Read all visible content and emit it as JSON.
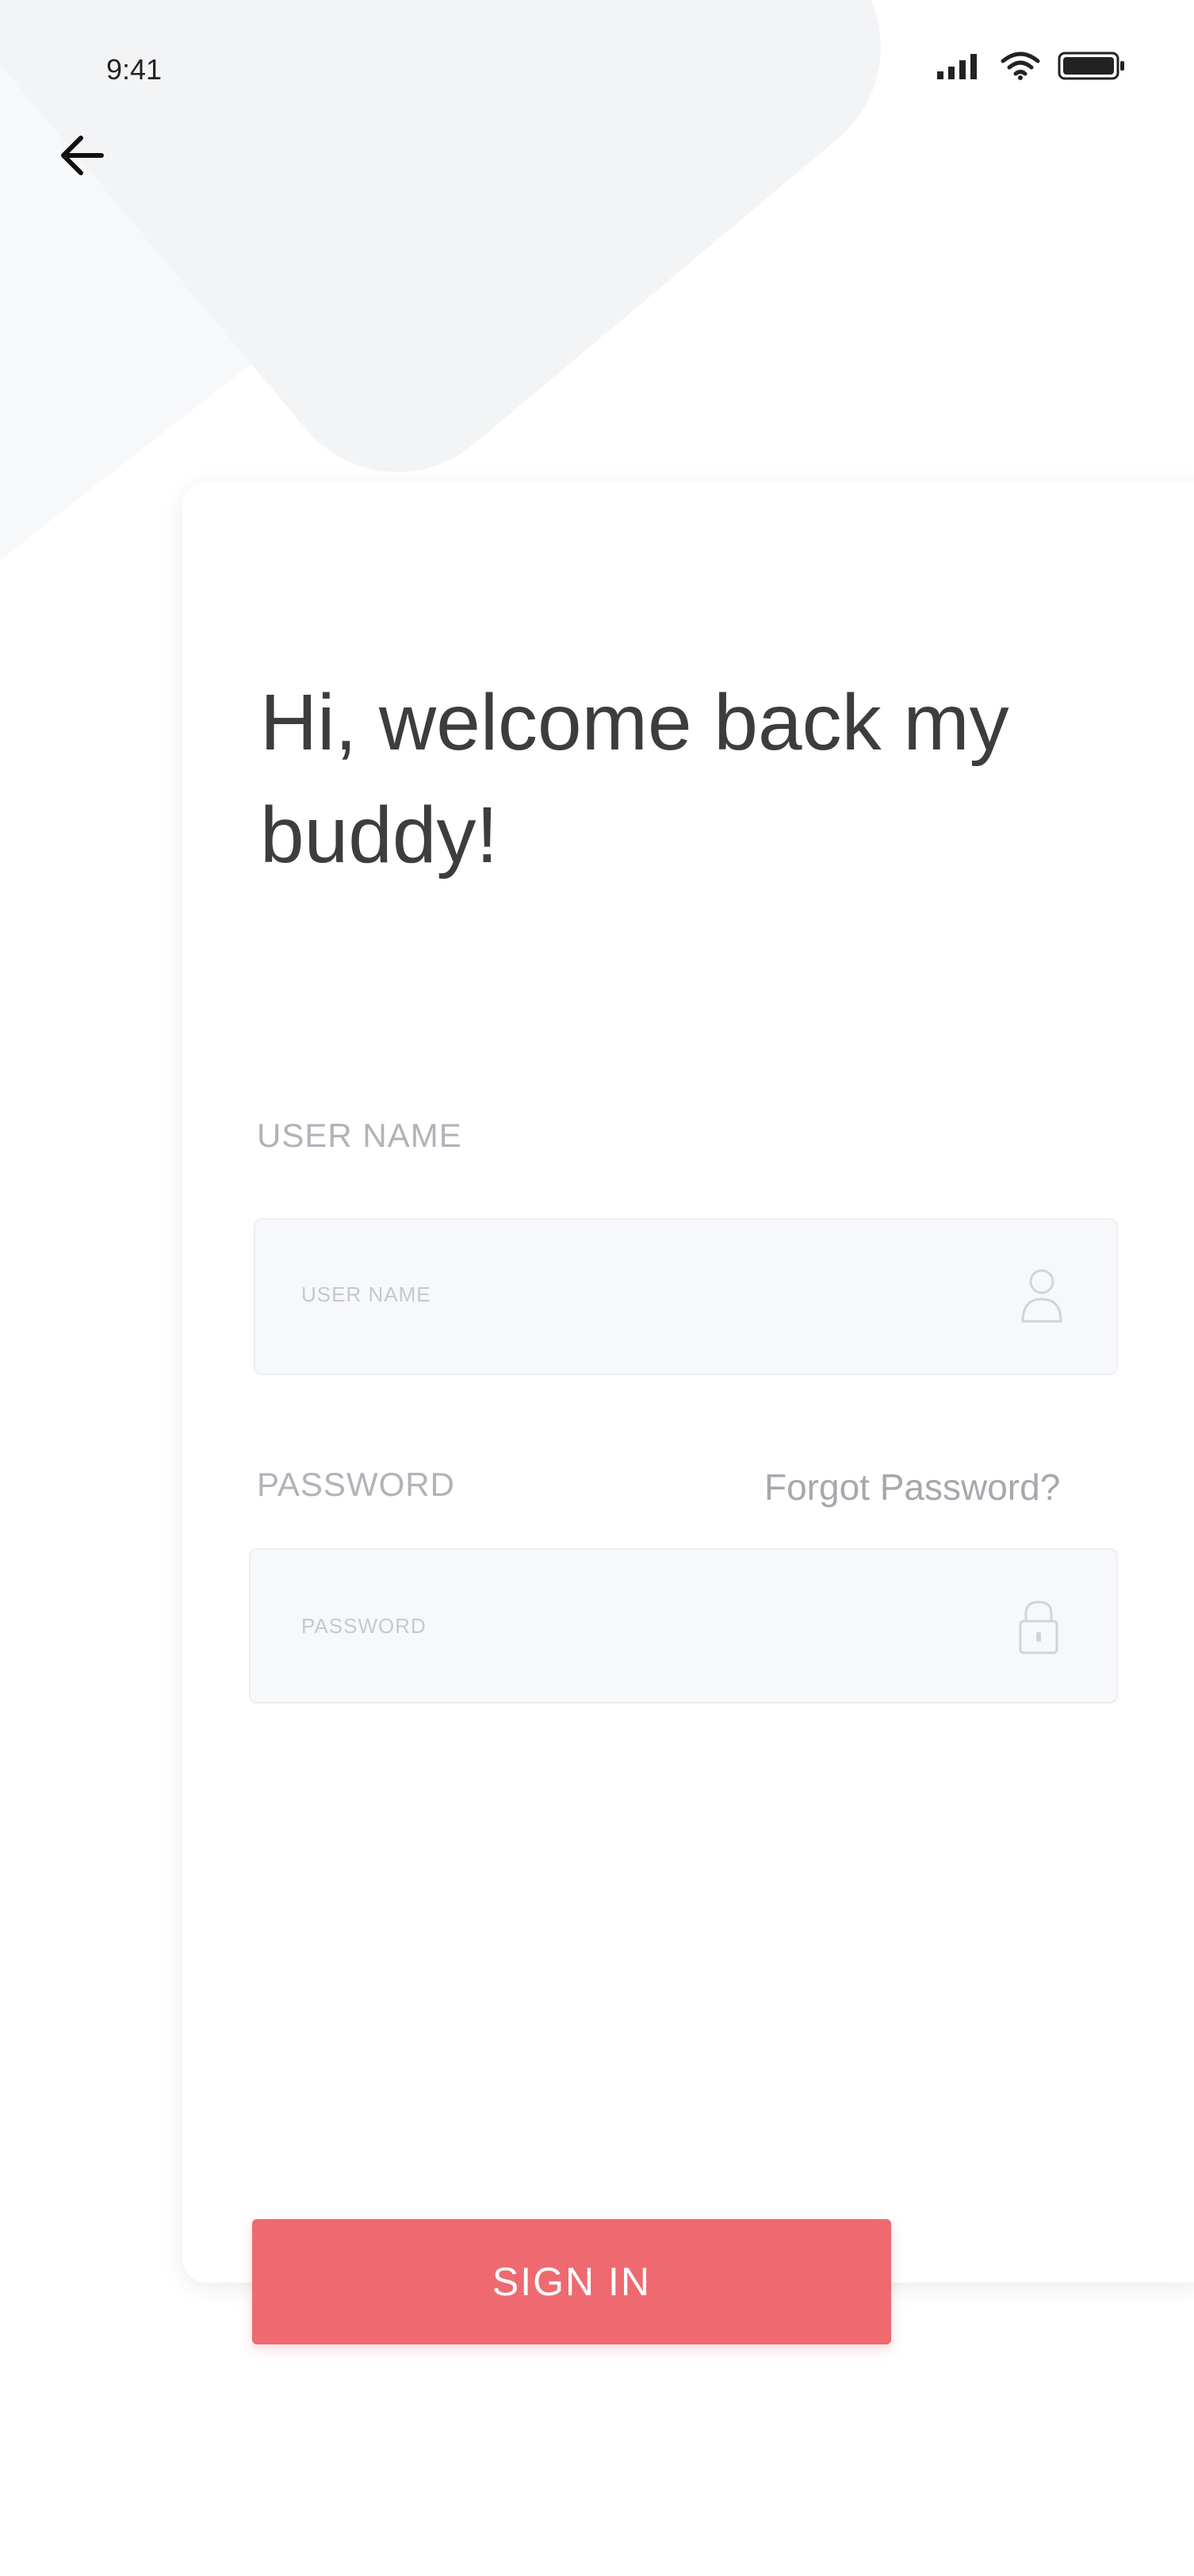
{
  "status_bar": {
    "time": "9:41",
    "icons": [
      "signal-icon",
      "wifi-icon",
      "battery-icon"
    ]
  },
  "nav": {
    "back_icon": "arrow-left-icon"
  },
  "welcome_text": "Hi, welcome back my buddy!",
  "username": {
    "label": "USER NAME",
    "placeholder": "USER NAME",
    "value": "",
    "icon": "user-icon"
  },
  "password": {
    "label": "PASSWORD",
    "placeholder": "PASSWORD",
    "value": "",
    "icon": "lock-icon",
    "forgot_label": "Forgot Password?"
  },
  "sign_in_label": "SIGN IN",
  "colors": {
    "accent": "#ee6a70",
    "title_text": "#3d3d3d",
    "muted_text": "#b0b3b8"
  }
}
